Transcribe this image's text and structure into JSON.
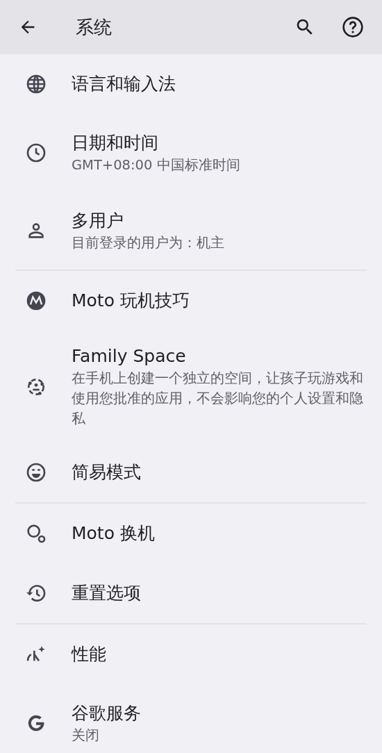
{
  "app_bar": {
    "title": "系统"
  },
  "groups": [
    [
      {
        "title": "语言和输入法"
      },
      {
        "title": "日期和时间",
        "subtitle": "GMT+08:00 中国标准时间"
      },
      {
        "title": "多用户",
        "subtitle": "目前登录的用户为：机主"
      }
    ],
    [
      {
        "title": "Moto 玩机技巧"
      },
      {
        "title": "Family Space",
        "subtitle": "在手机上创建一个独立的空间，让孩子玩游戏和使用您批准的应用，不会影响您的个人设置和隐私"
      },
      {
        "title": "简易模式"
      }
    ],
    [
      {
        "title": "Moto 换机"
      },
      {
        "title": "重置选项"
      }
    ],
    [
      {
        "title": "性能"
      },
      {
        "title": "谷歌服务",
        "subtitle": "关闭"
      }
    ]
  ]
}
